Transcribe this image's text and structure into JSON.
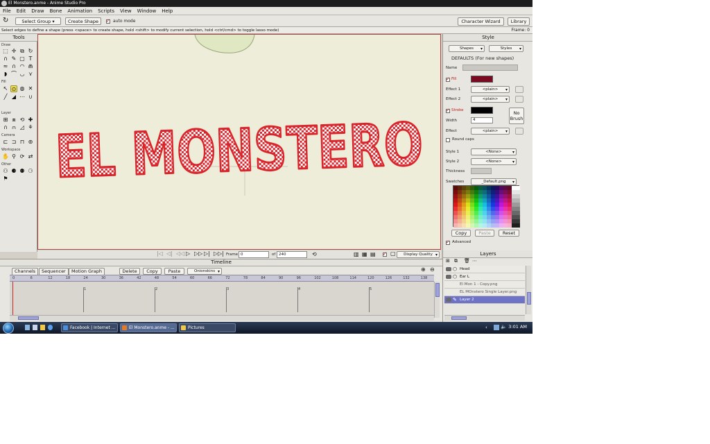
{
  "window": {
    "title": "El Monstero.anme - Anime Studio Pro"
  },
  "menu": [
    "File",
    "Edit",
    "Draw",
    "Bone",
    "Animation",
    "Scripts",
    "View",
    "Window",
    "Help"
  ],
  "toolbar": {
    "select_group": "Select Group",
    "create_shape": "Create Shape",
    "auto_mode": "auto mode",
    "character_wizard": "Character Wizard",
    "library": "Library"
  },
  "hint": "Select edges to define a shape (press <space> to create shape, hold <shift> to modify current selection, hold <ctrl/cmd> to toggle lasso mode)",
  "frame_readout": "Frame: 0",
  "tools": {
    "title": "Tools",
    "sections": [
      "Draw",
      "Fill",
      "Layer",
      "Camera",
      "Workspace",
      "Other"
    ]
  },
  "canvas": {
    "text": "EL MONSTERO",
    "text_color": "#d9262c"
  },
  "nav": {
    "frame_label": "Frame",
    "frame_value": "0",
    "of_label": "of",
    "total_value": "240",
    "display_quality": "Display Quality"
  },
  "style": {
    "title": "Style",
    "shapes_dd": "Shapes",
    "styles_dd": "Styles",
    "defaults": "DEFAULTS (For new shapes)",
    "name_label": "Name",
    "fill_label": "Fill",
    "fill_color": "#7a0a1f",
    "effect1_label": "Effect 1",
    "effect1_value": "<plain>",
    "effect2_label": "Effect 2",
    "effect2_value": "<plain>",
    "stroke_label": "Stroke",
    "stroke_color": "#000000",
    "no_brush": "No Brush",
    "width_label": "Width",
    "width_value": "4",
    "effect_label": "Effect",
    "effect_value": "<plain>",
    "round_caps": "Round caps",
    "style1_label": "Style 1",
    "style1_value": "<None>",
    "style2_label": "Style 2",
    "style2_value": "<None>",
    "thickness_label": "Thickness",
    "swatches_label": "Swatches",
    "swatches_value": "_Default.png",
    "copy": "Copy",
    "paste": "Paste",
    "reset": "Reset",
    "advanced": "Advanced"
  },
  "timeline": {
    "title": "Timeline",
    "tabs": [
      "Channels",
      "Sequencer",
      "Motion Graph"
    ],
    "delete": "Delete",
    "copy": "Copy",
    "paste": "Paste",
    "onionskins": "Onionskins",
    "ticks": [
      "0",
      "6",
      "12",
      "18",
      "24",
      "30",
      "36",
      "42",
      "48",
      "54",
      "60",
      "66",
      "72",
      "78",
      "84",
      "90",
      "96",
      "102",
      "108",
      "114",
      "120",
      "126",
      "132",
      "138"
    ],
    "keys": [
      "1",
      "2",
      "3",
      "4",
      "5"
    ]
  },
  "layers": {
    "title": "Layers",
    "rows": [
      {
        "name": "Head",
        "selected": false
      },
      {
        "name": "Ear L",
        "selected": false
      },
      {
        "name": "El Mon 1 - Copy.png",
        "selected": false
      },
      {
        "name": "EL MOnstero Single Layer.png",
        "selected": false
      },
      {
        "name": "Layer 2",
        "selected": true
      }
    ]
  },
  "taskbar": {
    "tasks": [
      {
        "label": "Facebook | Internet ...",
        "active": false
      },
      {
        "label": "El Monstero.anme - ...",
        "active": true
      },
      {
        "label": "Pictures",
        "active": false
      }
    ],
    "clock": "3:01 AM"
  }
}
